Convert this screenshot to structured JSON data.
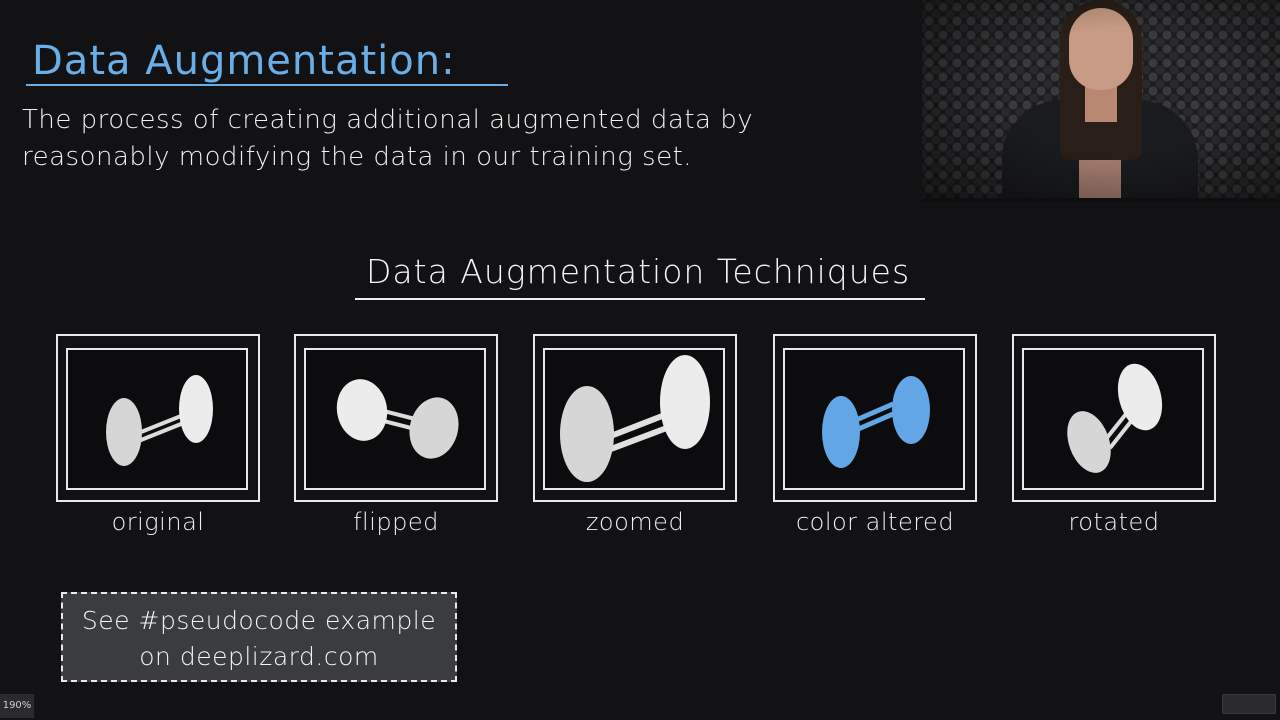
{
  "slide": {
    "title": "Data Augmentation:",
    "definition": "The process of creating additional augmented data by reasonably modifying the data in our training set.",
    "section_title": "Data Augmentation Techniques",
    "techniques": [
      {
        "label": "original",
        "transform": "none",
        "color": "#e6e6e6"
      },
      {
        "label": "flipped",
        "transform": "horizontal-flip",
        "color": "#e6e6e6"
      },
      {
        "label": "zoomed",
        "transform": "scale-up",
        "color": "#e6e6e6"
      },
      {
        "label": "color altered",
        "transform": "recolor",
        "color": "#62a6e6"
      },
      {
        "label": "rotated",
        "transform": "rotate",
        "color": "#e6e6e6"
      }
    ],
    "note_line1": "See #pseudocode example",
    "note_line2": "on deeplizard.com"
  },
  "colors": {
    "accent": "#6aaee8",
    "background": "#121114",
    "note_background": "#3b3c40"
  },
  "webcam": {
    "description": "presenter video feed"
  },
  "player": {
    "zoom_level": "190%",
    "bottom_right_button": ""
  }
}
